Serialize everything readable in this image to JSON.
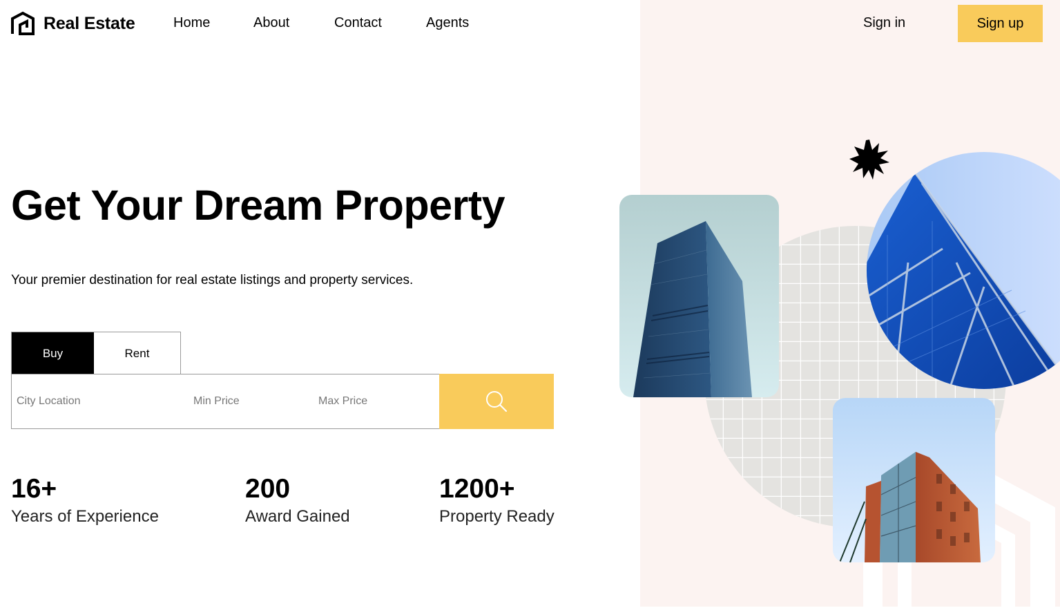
{
  "brand": {
    "name": "Real Estate",
    "icon": "house-logo-icon"
  },
  "nav": {
    "items": [
      {
        "label": "Home"
      },
      {
        "label": "About"
      },
      {
        "label": "Contact"
      },
      {
        "label": "Agents"
      }
    ],
    "signin_label": "Sign in",
    "signup_label": "Sign up"
  },
  "hero": {
    "title": "Get Your Dream Property",
    "subtitle": "Your premier destination for real estate listings and property services."
  },
  "search": {
    "tabs": [
      {
        "label": "Buy",
        "active": true
      },
      {
        "label": "Rent",
        "active": false
      }
    ],
    "city_placeholder": "City Location",
    "min_price_placeholder": "Min Price",
    "max_price_placeholder": "Max Price",
    "button_icon": "search-icon"
  },
  "stats": [
    {
      "number": "16+",
      "label": "Years of Experience"
    },
    {
      "number": "200",
      "label": "Award Gained"
    },
    {
      "number": "1200+",
      "label": "Property Ready"
    }
  ],
  "colors": {
    "accent": "#f9cb5b",
    "panel": "#fcf3f1",
    "dark": "#000000"
  },
  "images": [
    "tower-photo",
    "glass-building-photo",
    "brick-building-photo"
  ]
}
